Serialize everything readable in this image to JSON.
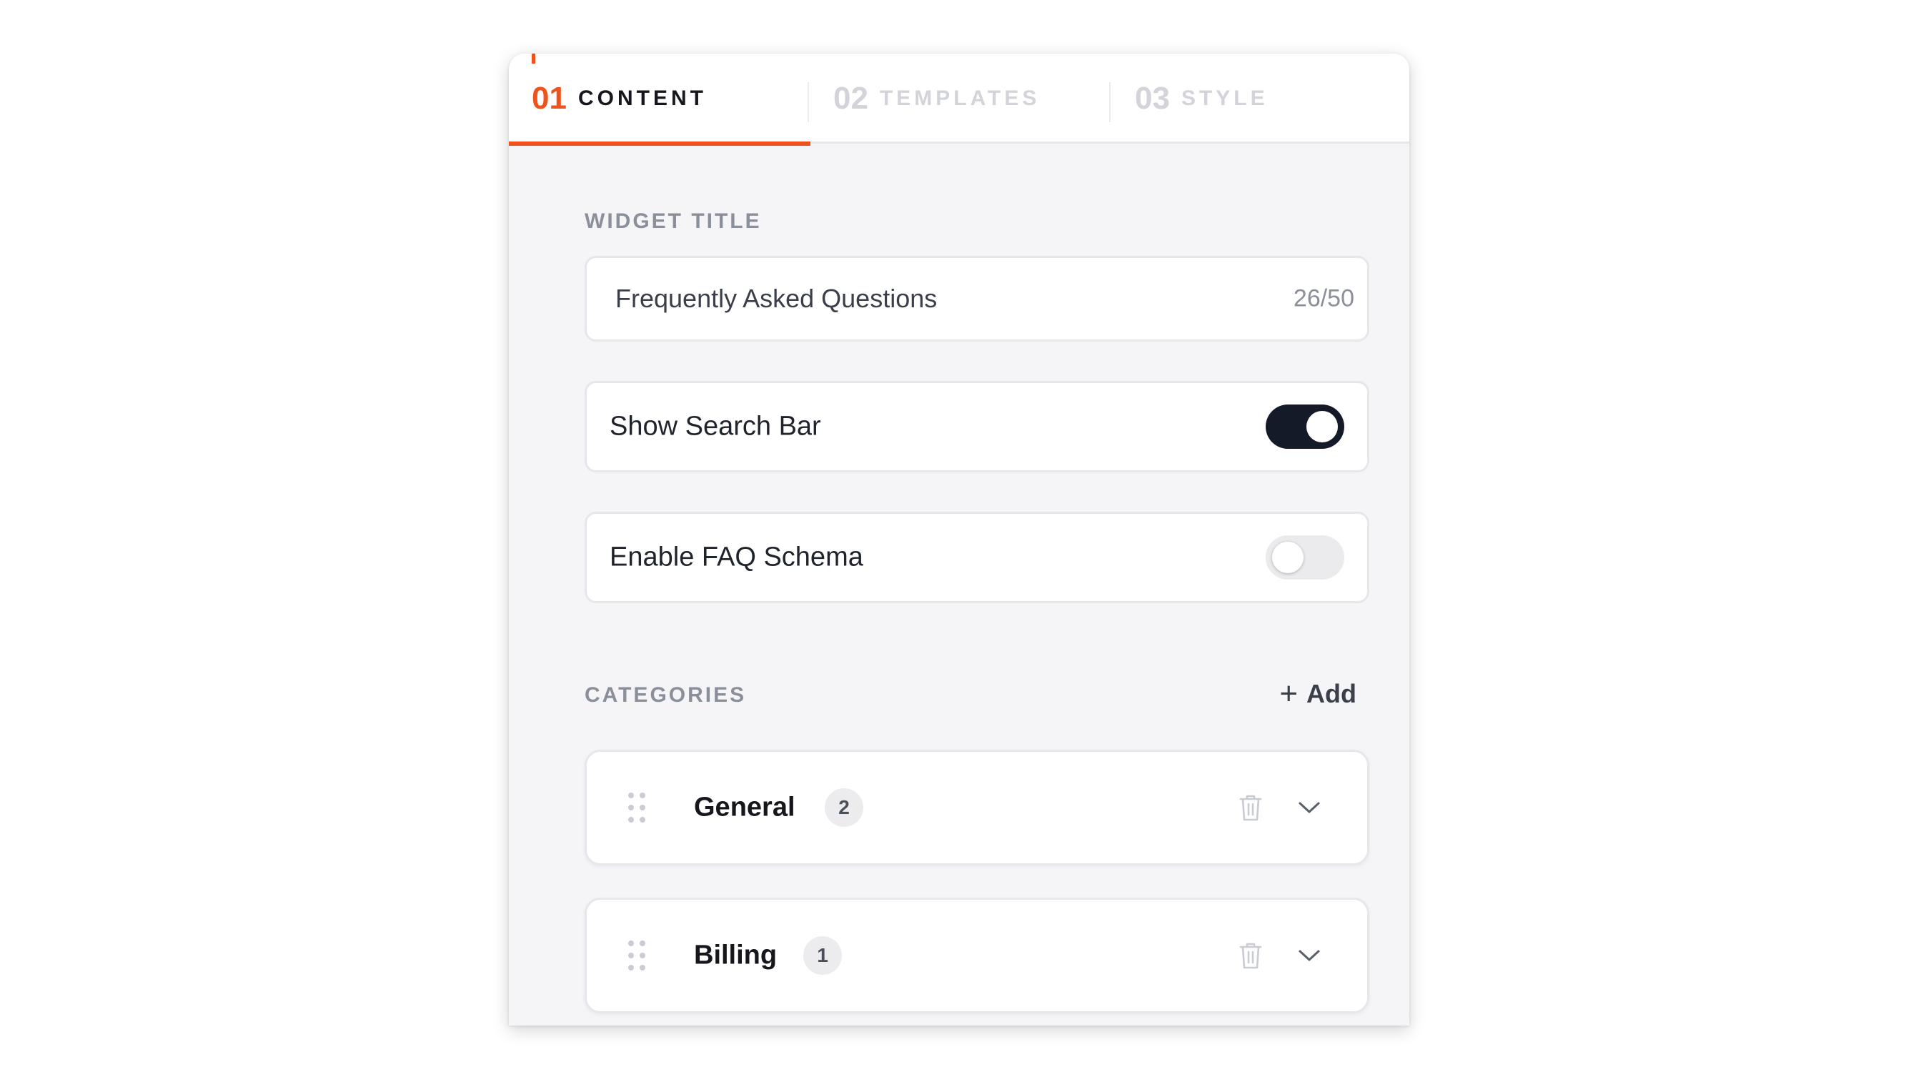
{
  "tabs": [
    {
      "number": "01",
      "label": "CONTENT",
      "active": true
    },
    {
      "number": "02",
      "label": "TEMPLATES",
      "active": false
    },
    {
      "number": "03",
      "label": "STYLE",
      "active": false
    }
  ],
  "widget_title": {
    "section_label": "WIDGET TITLE",
    "value": "Frequently Asked Questions",
    "counter": "26/50"
  },
  "toggles": [
    {
      "label": "Show Search Bar",
      "state": "on"
    },
    {
      "label": "Enable FAQ Schema",
      "state": "off"
    }
  ],
  "categories": {
    "section_label": "CATEGORIES",
    "add_label": "Add",
    "add_icon": "plus-icon",
    "items": [
      {
        "name": "General",
        "count": "2",
        "icons": [
          "drag-handle-icon",
          "trash-icon",
          "chevron-down-icon"
        ]
      },
      {
        "name": "Billing",
        "count": "1",
        "icons": [
          "drag-handle-icon",
          "trash-icon",
          "chevron-down-icon"
        ]
      }
    ]
  },
  "colors": {
    "accent": "#f0521c",
    "toggle_on": "#141a28",
    "toggle_off": "#ebebee",
    "muted_text": "#8a8f9a"
  }
}
